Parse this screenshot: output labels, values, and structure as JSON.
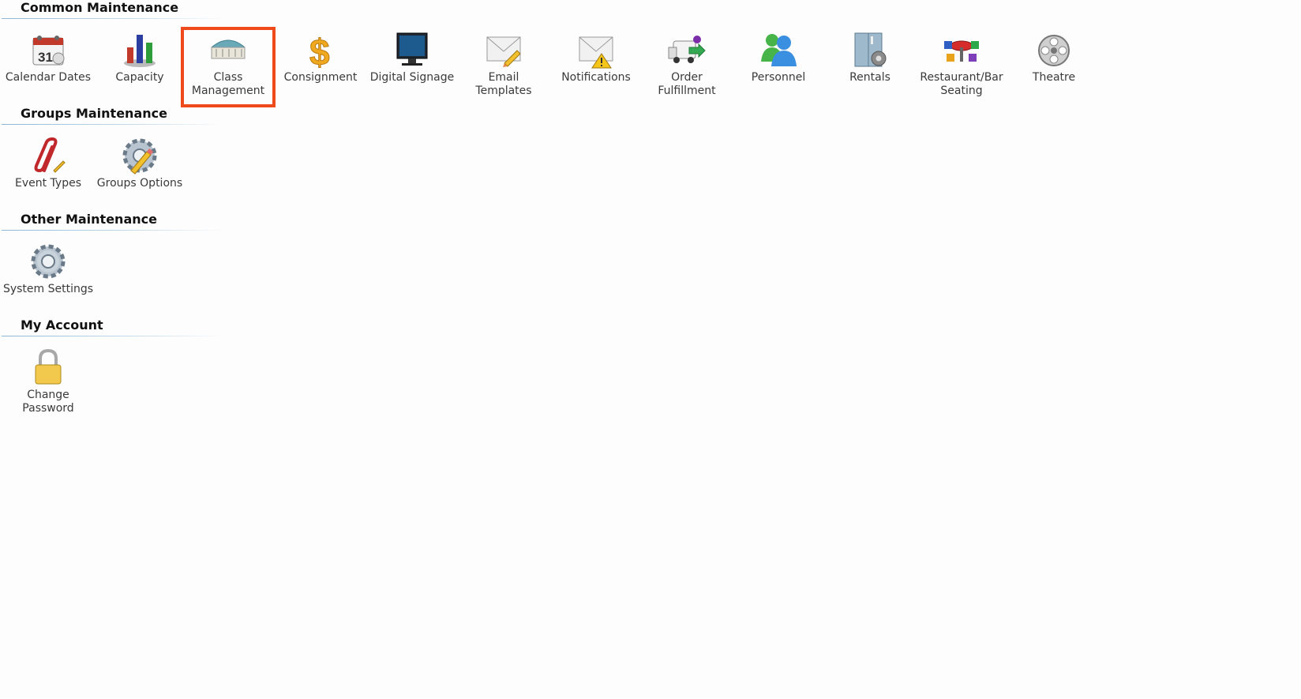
{
  "sections": {
    "common": {
      "title": "Common Maintenance",
      "items": [
        {
          "label": "Calendar Dates",
          "icon": "calendar-icon"
        },
        {
          "label": "Capacity",
          "icon": "bar-chart-icon"
        },
        {
          "label": "Class\nManagement",
          "icon": "building-icon",
          "selected": true
        },
        {
          "label": "Consignment",
          "icon": "dollar-icon"
        },
        {
          "label": "Digital Signage",
          "icon": "monitor-icon"
        },
        {
          "label": "Email\nTemplates",
          "icon": "envelope-pencil-icon"
        },
        {
          "label": "Notifications",
          "icon": "envelope-warning-icon"
        },
        {
          "label": "Order\nFulfillment",
          "icon": "delivery-truck-icon"
        },
        {
          "label": "Personnel",
          "icon": "people-icon"
        },
        {
          "label": "Rentals",
          "icon": "locker-gear-icon"
        },
        {
          "label": "Restaurant/Bar\nSeating",
          "icon": "table-chairs-icon"
        },
        {
          "label": "Theatre",
          "icon": "film-reel-icon"
        }
      ]
    },
    "groups": {
      "title": "Groups Maintenance",
      "items": [
        {
          "label": "Event Types",
          "icon": "paperclip-icon"
        },
        {
          "label": "Groups Options",
          "icon": "gear-pencil-icon"
        }
      ]
    },
    "other": {
      "title": "Other Maintenance",
      "items": [
        {
          "label": "System Settings",
          "icon": "gear-icon"
        }
      ]
    },
    "account": {
      "title": "My Account",
      "items": [
        {
          "label": "Change\nPassword",
          "icon": "padlock-icon"
        }
      ]
    }
  },
  "colors": {
    "selection_border": "#ef4a1c",
    "section_rule": "#8fb6d4"
  }
}
